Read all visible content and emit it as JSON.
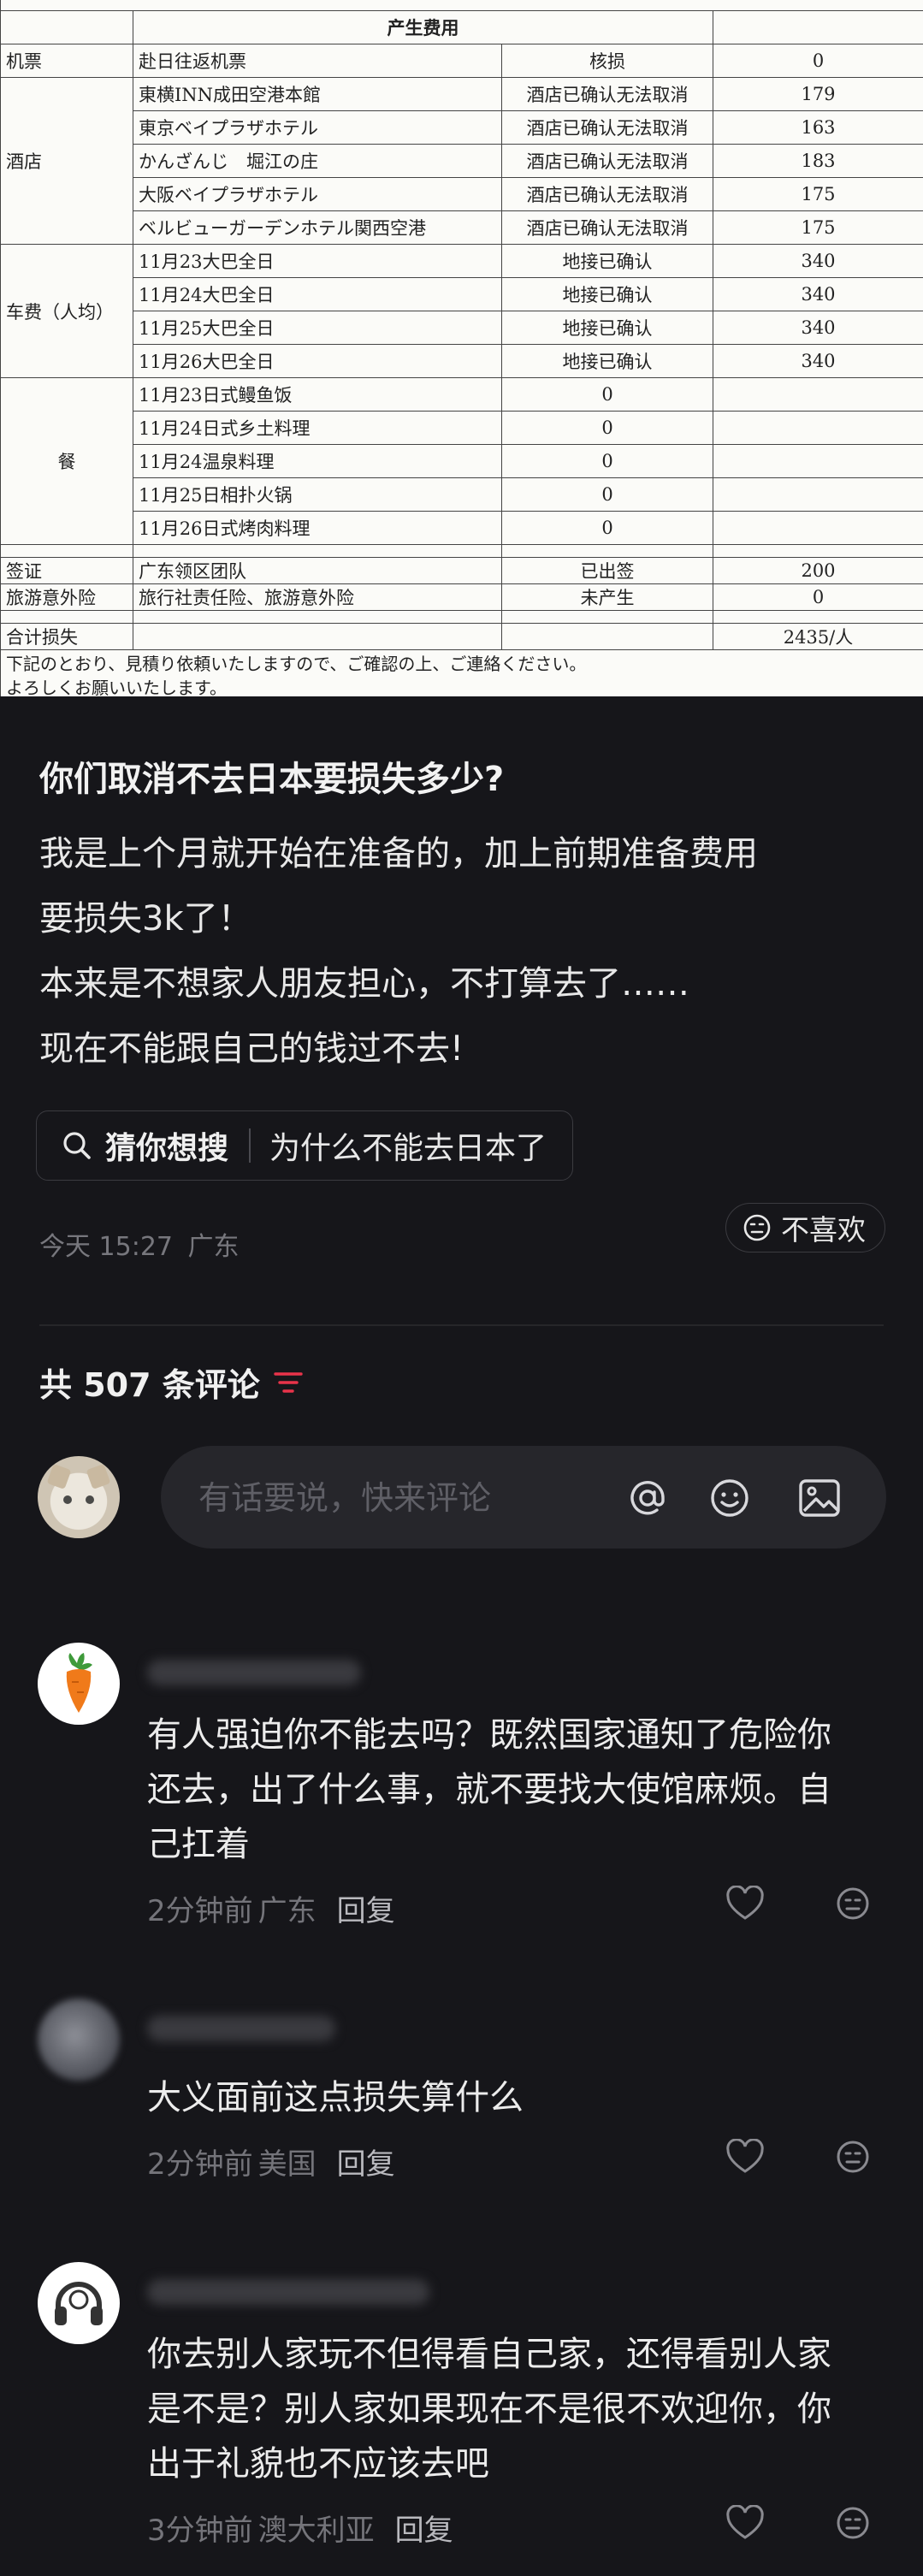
{
  "table": {
    "header": "产生费用",
    "rows": [
      {
        "cat": "机票",
        "item": "赴日往返机票",
        "status": "核损",
        "amount": "0"
      },
      {
        "cat": "酒店",
        "item": "東横INN成田空港本館",
        "status": "酒店已确认无法取消",
        "amount": "179"
      },
      {
        "item": "東京ベイプラザホテル",
        "status": "酒店已确认无法取消",
        "amount": "163"
      },
      {
        "item": "かんざんじ　堀江の庄",
        "status": "酒店已确认无法取消",
        "amount": "183"
      },
      {
        "item": "大阪ベイプラザホテル",
        "status": "酒店已确认无法取消",
        "amount": "175"
      },
      {
        "item": "ベルビューガーデンホテル関西空港",
        "status": "酒店已确认无法取消",
        "amount": "175"
      },
      {
        "cat": "车费（人均）",
        "item": "11月23大巴全日",
        "status": "地接已确认",
        "amount": "340"
      },
      {
        "item": "11月24大巴全日",
        "status": "地接已确认",
        "amount": "340"
      },
      {
        "item": "11月25大巴全日",
        "status": "地接已确认",
        "amount": "340"
      },
      {
        "item": "11月26大巴全日",
        "status": "地接已确认",
        "amount": "340"
      },
      {
        "cat": "餐",
        "item": "11月23日式鳗鱼饭",
        "status": "0",
        "amount": ""
      },
      {
        "item": "11月24日式乡土料理",
        "status": "0",
        "amount": ""
      },
      {
        "item": "11月24温泉料理",
        "status": "0",
        "amount": ""
      },
      {
        "item": "11月25日相扑火锅",
        "status": "0",
        "amount": ""
      },
      {
        "item": "11月26日式烤肉料理",
        "status": "0",
        "amount": ""
      },
      {
        "cat": "签证",
        "item": "广东领区团队",
        "status": "已出签",
        "amount": "200"
      },
      {
        "cat": "旅游意外险",
        "item": "旅行社责任险、旅游意外险",
        "status": "未产生",
        "amount": "0"
      }
    ],
    "total_label": "合计损失",
    "total_value": "2435/人",
    "note_line1": "下記のとおり、見積り依頼いたしますので、ご確認の上、ご連絡ください。",
    "note_line2": "よろしくお願いいたします。"
  },
  "post": {
    "title": "你们取消不去日本要损失多少?",
    "body": [
      "我是上个月就开始在准备的，加上前期准备费用",
      "要损失3k了！",
      "本来是不想家人朋友担心，不打算去了……",
      "现在不能跟自己的钱过不去!"
    ],
    "guess_label": "猜你想搜",
    "guess_query": "为什么不能去日本了",
    "time": "今天 15:27",
    "location": "广东",
    "dislike_label": "不喜欢"
  },
  "comments_header": {
    "label": "共 507 条评论",
    "accent_color": "#e8334a"
  },
  "comment_input": {
    "placeholder": "有话要说，快来评论"
  },
  "comments": [
    {
      "avatar": "carrot-avatar",
      "lines": [
        "有人强迫你不能去吗？既然国家通知了危险你",
        "还去，出了什么事，就不要找大使馆麻烦。自",
        "己扛着"
      ],
      "time": "2分钟前",
      "location": "广东",
      "reply_label": "回复"
    },
    {
      "avatar": "blurred-avatar",
      "lines": [
        "大义面前这点损失算什么"
      ],
      "time": "2分钟前",
      "location": "美国",
      "reply_label": "回复"
    },
    {
      "avatar": "headphones-avatar",
      "lines": [
        "你去别人家玩不但得看自己家，还得看别人家",
        "是不是？别人家如果现在不是很不欢迎你，你",
        "出于礼貌也不应该去吧"
      ],
      "time": "3分钟前",
      "location": "澳大利亚",
      "reply_label": "回复"
    }
  ],
  "colors": {
    "background": "#16161a",
    "accent": "#e8334a"
  }
}
